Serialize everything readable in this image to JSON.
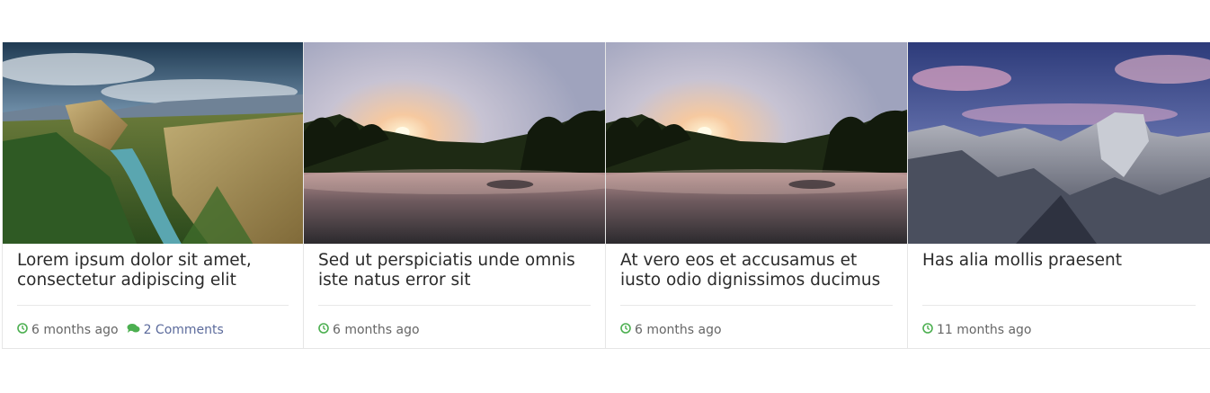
{
  "accent_color": "#4caf50",
  "posts": [
    {
      "title": "Lorem ipsum dolor sit amet, consectetur adipiscing elit",
      "date": "6 months ago",
      "comments": "2 Comments",
      "image": "river-canyon-landscape"
    },
    {
      "title": "Sed ut perspiciatis unde omnis iste natus error sit",
      "date": "6 months ago",
      "image": "sunset-lake-palms"
    },
    {
      "title": "At vero eos et accusamus et iusto odio dignissimos ducimus",
      "date": "6 months ago",
      "image": "sunset-lake-palms"
    },
    {
      "title": "Has alia mollis praesent",
      "date": "11 months ago",
      "image": "mountain-granite-dusk"
    }
  ]
}
